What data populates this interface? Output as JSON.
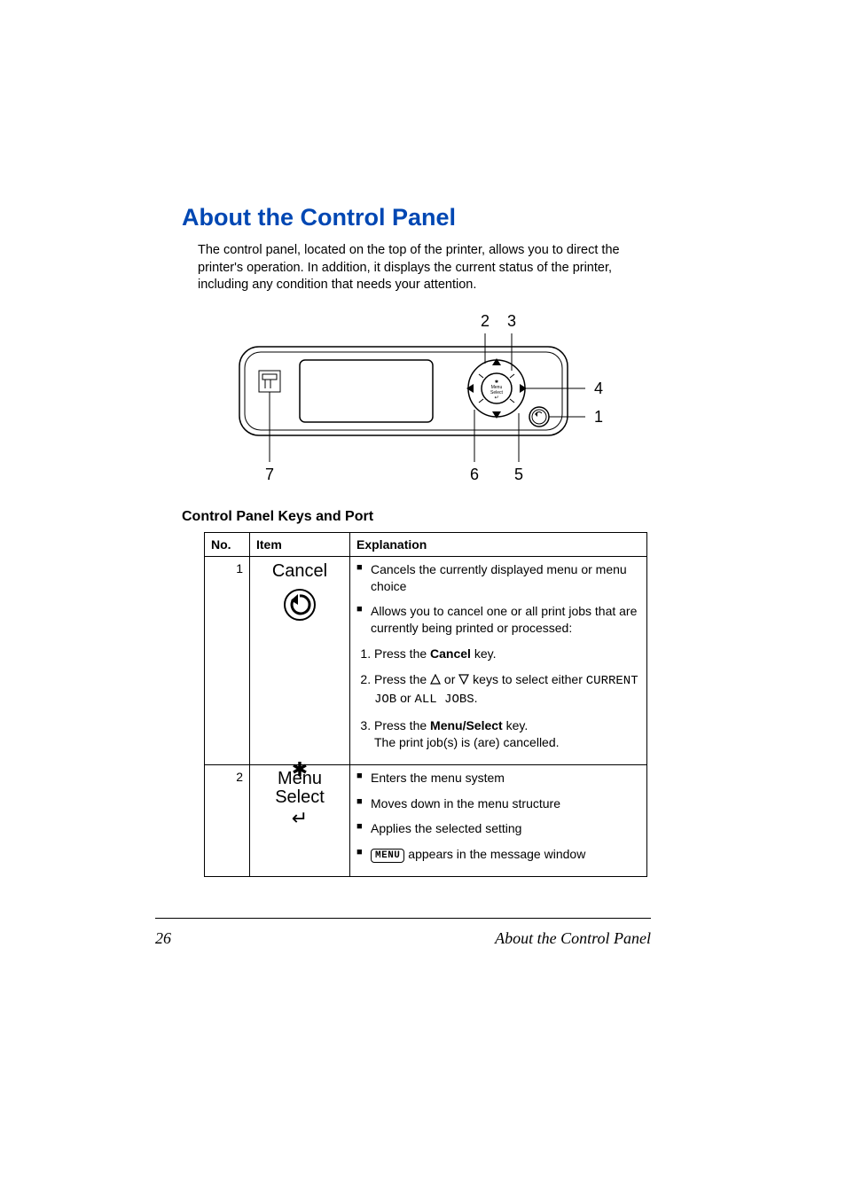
{
  "heading": "About the Control Panel",
  "intro": "The control panel, located on the top of the printer, allows you to direct the printer's operation. In addition, it displays the current status of the printer, including any condition that needs your attention.",
  "diagram": {
    "callouts": [
      "2",
      "3",
      "4",
      "1",
      "5",
      "6",
      "7"
    ],
    "menu_select_label_top": "Menu",
    "menu_select_label_bottom": "Select"
  },
  "subheading": "Control Panel Keys and Port",
  "table": {
    "headers": {
      "no": "No.",
      "item": "Item",
      "explanation": "Explanation"
    },
    "rows": [
      {
        "no": "1",
        "item_label": "Cancel",
        "exp": {
          "b1": "Cancels the currently displayed menu or menu choice",
          "b2": "Allows you to cancel one or all print jobs that are currently being printed or processed:",
          "s1a": "Press the ",
          "s1b": "Cancel",
          "s1c": " key.",
          "s2a": "Press the ",
          "s2b": " or ",
          "s2c": " keys to select either ",
          "s2d": "CUR­RENT JOB",
          "s2e": " or ",
          "s2f": "ALL JOBS",
          "s2g": ".",
          "s3a": "Press the ",
          "s3b": "Menu/Select",
          "s3c": " key.",
          "s3d": "The print job(s) is (are) cancelled."
        }
      },
      {
        "no": "2",
        "item_label_top": "Menu",
        "item_label_bottom": "Select",
        "exp": {
          "b1": " Enters the menu system",
          "b2": " Moves down in the menu structure",
          "b3": " Applies the selected setting",
          "b4_chip": "MENU",
          "b4_rest": " appears in the message window"
        }
      }
    ]
  },
  "footer": {
    "page": "26",
    "title": "About the Control Panel"
  }
}
